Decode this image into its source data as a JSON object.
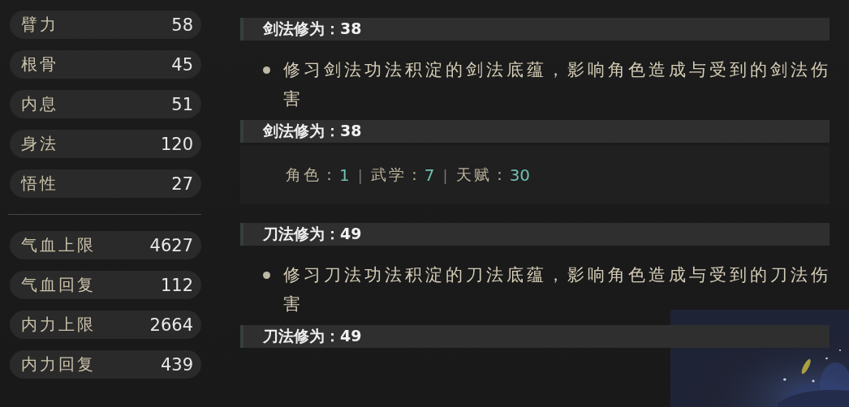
{
  "attributes": [
    {
      "label": "臂力",
      "value": "58"
    },
    {
      "label": "根骨",
      "value": "45"
    },
    {
      "label": "内息",
      "value": "51"
    },
    {
      "label": "身法",
      "value": "120"
    },
    {
      "label": "悟性",
      "value": "27"
    }
  ],
  "derived_stats": [
    {
      "label": "气血上限",
      "value": "4627"
    },
    {
      "label": "气血回复",
      "value": "112"
    },
    {
      "label": "内力上限",
      "value": "2664"
    },
    {
      "label": "内力回复",
      "value": "439"
    }
  ],
  "sections": [
    {
      "kind": "description",
      "title": "剑法修为：38",
      "text": "修习剑法功法积淀的剑法底蕴，影响角色造成与受到的剑法伤害"
    },
    {
      "kind": "breakdown",
      "title": "剑法修为：38",
      "separator": "|",
      "parts": [
        {
          "label": "角色：",
          "value": "1"
        },
        {
          "label": "武学：",
          "value": "7"
        },
        {
          "label": "天赋：",
          "value": "30"
        }
      ]
    },
    {
      "kind": "description",
      "title": "刀法修为：49",
      "text": "修习刀法功法积淀的刀法底蕴，影响角色造成与受到的刀法伤害"
    },
    {
      "kind": "header",
      "title": "刀法修为：49"
    }
  ]
}
